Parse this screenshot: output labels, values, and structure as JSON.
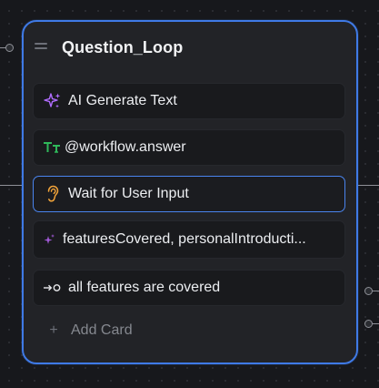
{
  "node": {
    "title": "Question_Loop",
    "accent_color": "#3f7ae6",
    "cards": [
      {
        "icon": "sparkles-icon",
        "icon_color": "#b06cff",
        "label": "AI Generate Text",
        "selected": false
      },
      {
        "icon": "text-variable-icon",
        "icon_color": "#2fb85a",
        "label": "@workflow.answer",
        "selected": false
      },
      {
        "icon": "ear-icon",
        "icon_color": "#f2a43a",
        "label": "Wait for User Input",
        "selected": true
      },
      {
        "icon": "small-sparkles-icon",
        "icon_color": "#a25ad8",
        "label": "featuresCovered, personalIntroducti...",
        "selected": false
      },
      {
        "icon": "condition-arrow-icon",
        "icon_color": "#e8e9ec",
        "label": "all features are covered",
        "selected": false
      }
    ],
    "add_card_label": "Add Card"
  }
}
